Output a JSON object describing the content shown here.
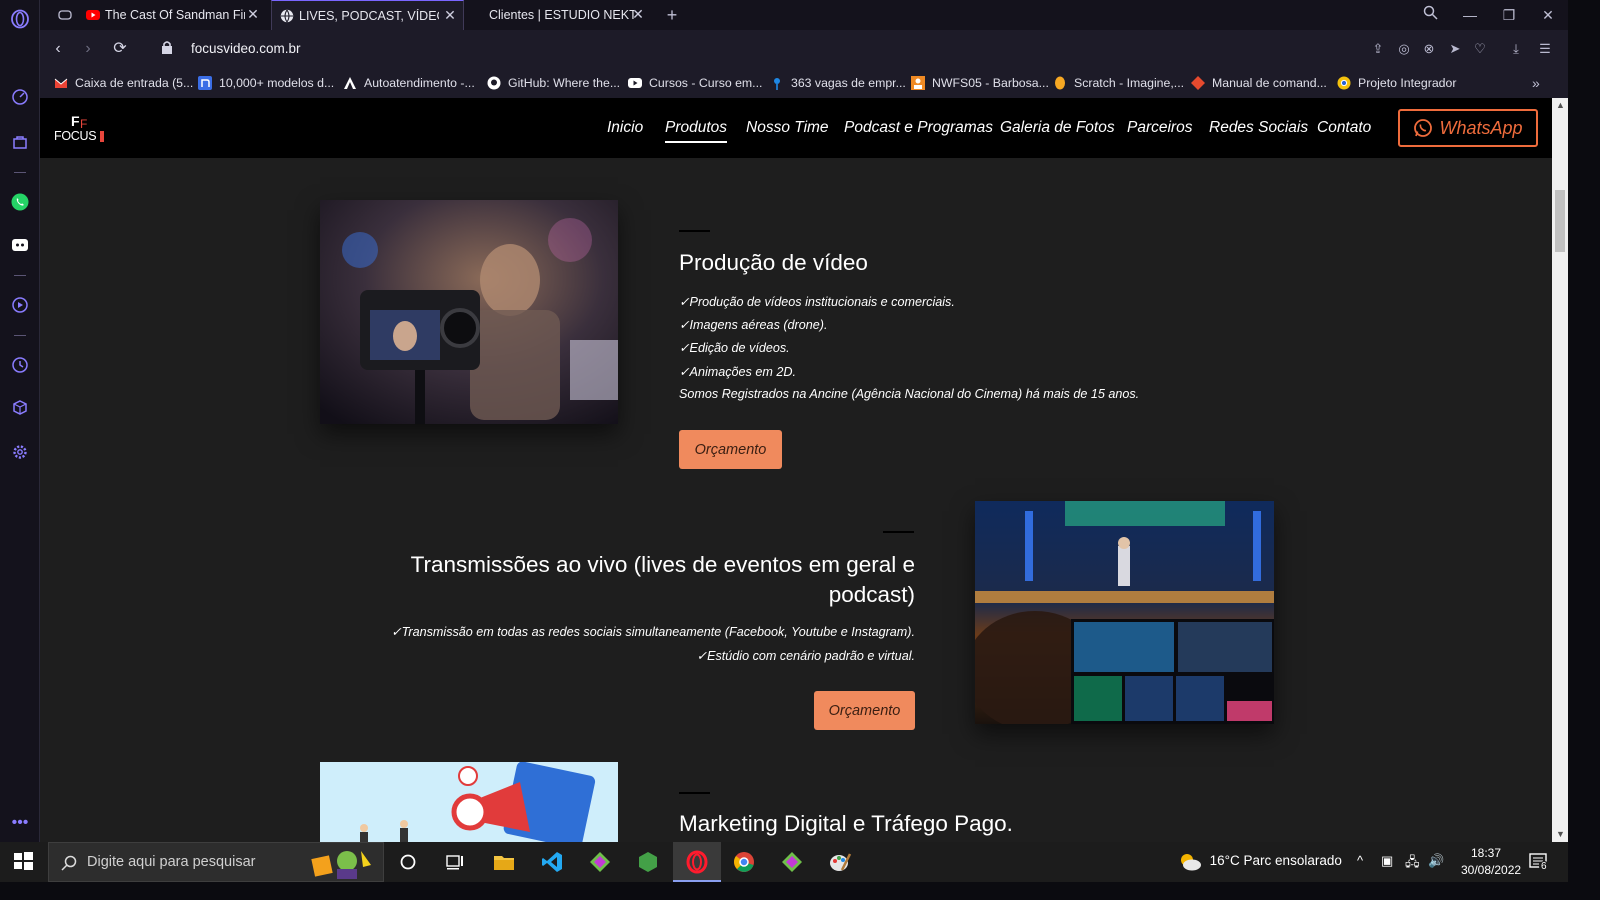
{
  "browser": {
    "tabs": [
      {
        "title": "The Cast Of Sandman Finds",
        "icon": "youtube-icon",
        "active": false
      },
      {
        "title": "LIVES, PODCAST, VÍDEOS, E",
        "icon": "globe-icon",
        "active": true
      },
      {
        "title": "Clientes | ESTUDIO NEKTAR",
        "icon": "",
        "active": false
      }
    ],
    "url": "focusvideo.com.br",
    "bookmarks": [
      {
        "label": "Caixa de entrada (5...",
        "icon": "gmail-icon"
      },
      {
        "label": "10,000+ modelos d...",
        "icon": "notion-icon"
      },
      {
        "label": "Autoatendimento -...",
        "icon": "triangle-icon"
      },
      {
        "label": "GitHub: Where the...",
        "icon": "github-icon"
      },
      {
        "label": "Cursos - Curso em...",
        "icon": "youtube-icon"
      },
      {
        "label": "363 vagas de empr...",
        "icon": "pin-icon"
      },
      {
        "label": "NWFS05 - Barbosa...",
        "icon": "person-icon"
      },
      {
        "label": "Scratch - Imagine,...",
        "icon": "scratch-icon"
      },
      {
        "label": "Manual de comand...",
        "icon": "git-icon"
      },
      {
        "label": "Projeto Integrador",
        "icon": "chrome-icon"
      }
    ]
  },
  "site": {
    "logo_text": "FOCUS",
    "nav": [
      "Inicio",
      "Produtos",
      "Nosso Time",
      "Podcast e Programas",
      "Galeria de Fotos",
      "Parceiros",
      "Redes Sociais",
      "Contato"
    ],
    "active_nav": "Produtos",
    "whatsapp_label": "WhatsApp",
    "sections": [
      {
        "title": "Produção de vídeo",
        "features": [
          "✓Produção de vídeos institucionais e comerciais.",
          "✓Imagens aéreas (drone).",
          "✓Edição de vídeos.",
          "✓Animações em 2D.",
          "Somos Registrados na Ancine (Agência Nacional do Cinema) há mais de 15 anos."
        ],
        "button": "Orçamento"
      },
      {
        "title_line1": "Transmissões ao vivo (lives de eventos em geral e",
        "title_line2": "podcast)",
        "features": [
          "✓Transmissão em todas as redes sociais simultaneamente (Facebook, Youtube e Instagram).",
          "✓Estúdio com cenário padrão e virtual."
        ],
        "button": "Orçamento"
      },
      {
        "title": "Marketing Digital e Tráfego Pago."
      }
    ]
  },
  "taskbar": {
    "search_placeholder": "Digite aqui para pesquisar",
    "weather": "16°C  Parc ensolarado",
    "time": "18:37",
    "date": "30/08/2022",
    "notifications": "6"
  },
  "colors": {
    "accent_orange": "#f08a5d",
    "whatsapp_border": "#ef6c3c",
    "opera_purple": "#7a66ff"
  }
}
